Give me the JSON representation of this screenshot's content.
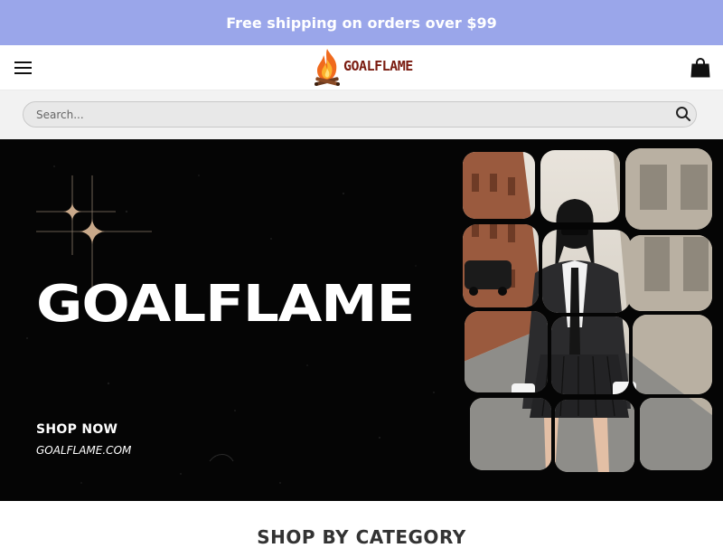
{
  "promo": {
    "text": "Free shipping on orders over $99"
  },
  "header": {
    "logo_text": "GOALFLAME",
    "menu_icon": "hamburger-menu-icon",
    "cart_icon": "shopping-bag-icon"
  },
  "search": {
    "placeholder": "Search...",
    "value": ""
  },
  "hero": {
    "title": "GOALFLAME",
    "cta_label": "SHOP NOW",
    "site": "GOALFLAME.COM"
  },
  "sections": {
    "category_heading": "SHOP BY CATEGORY"
  },
  "colors": {
    "promo_bg": "#9aa6ea",
    "hero_bg": "#050505",
    "logo_text": "#7a1b10",
    "sparkle": "#c9a98a"
  }
}
